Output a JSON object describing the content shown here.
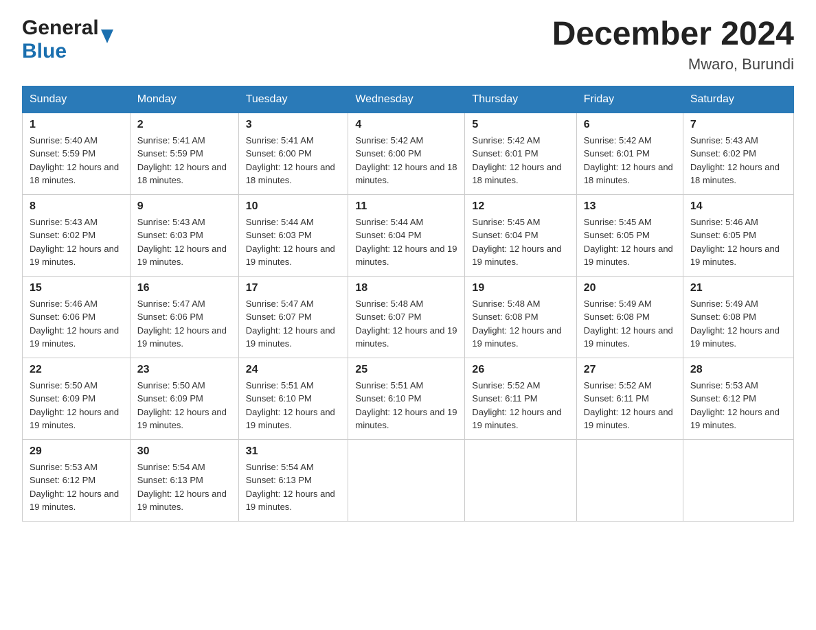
{
  "logo": {
    "general": "General",
    "blue": "Blue"
  },
  "title": "December 2024",
  "location": "Mwaro, Burundi",
  "days_header": [
    "Sunday",
    "Monday",
    "Tuesday",
    "Wednesday",
    "Thursday",
    "Friday",
    "Saturday"
  ],
  "weeks": [
    [
      {
        "day": "1",
        "sunrise": "5:40 AM",
        "sunset": "5:59 PM",
        "daylight": "12 hours and 18 minutes."
      },
      {
        "day": "2",
        "sunrise": "5:41 AM",
        "sunset": "5:59 PM",
        "daylight": "12 hours and 18 minutes."
      },
      {
        "day": "3",
        "sunrise": "5:41 AM",
        "sunset": "6:00 PM",
        "daylight": "12 hours and 18 minutes."
      },
      {
        "day": "4",
        "sunrise": "5:42 AM",
        "sunset": "6:00 PM",
        "daylight": "12 hours and 18 minutes."
      },
      {
        "day": "5",
        "sunrise": "5:42 AM",
        "sunset": "6:01 PM",
        "daylight": "12 hours and 18 minutes."
      },
      {
        "day": "6",
        "sunrise": "5:42 AM",
        "sunset": "6:01 PM",
        "daylight": "12 hours and 18 minutes."
      },
      {
        "day": "7",
        "sunrise": "5:43 AM",
        "sunset": "6:02 PM",
        "daylight": "12 hours and 18 minutes."
      }
    ],
    [
      {
        "day": "8",
        "sunrise": "5:43 AM",
        "sunset": "6:02 PM",
        "daylight": "12 hours and 19 minutes."
      },
      {
        "day": "9",
        "sunrise": "5:43 AM",
        "sunset": "6:03 PM",
        "daylight": "12 hours and 19 minutes."
      },
      {
        "day": "10",
        "sunrise": "5:44 AM",
        "sunset": "6:03 PM",
        "daylight": "12 hours and 19 minutes."
      },
      {
        "day": "11",
        "sunrise": "5:44 AM",
        "sunset": "6:04 PM",
        "daylight": "12 hours and 19 minutes."
      },
      {
        "day": "12",
        "sunrise": "5:45 AM",
        "sunset": "6:04 PM",
        "daylight": "12 hours and 19 minutes."
      },
      {
        "day": "13",
        "sunrise": "5:45 AM",
        "sunset": "6:05 PM",
        "daylight": "12 hours and 19 minutes."
      },
      {
        "day": "14",
        "sunrise": "5:46 AM",
        "sunset": "6:05 PM",
        "daylight": "12 hours and 19 minutes."
      }
    ],
    [
      {
        "day": "15",
        "sunrise": "5:46 AM",
        "sunset": "6:06 PM",
        "daylight": "12 hours and 19 minutes."
      },
      {
        "day": "16",
        "sunrise": "5:47 AM",
        "sunset": "6:06 PM",
        "daylight": "12 hours and 19 minutes."
      },
      {
        "day": "17",
        "sunrise": "5:47 AM",
        "sunset": "6:07 PM",
        "daylight": "12 hours and 19 minutes."
      },
      {
        "day": "18",
        "sunrise": "5:48 AM",
        "sunset": "6:07 PM",
        "daylight": "12 hours and 19 minutes."
      },
      {
        "day": "19",
        "sunrise": "5:48 AM",
        "sunset": "6:08 PM",
        "daylight": "12 hours and 19 minutes."
      },
      {
        "day": "20",
        "sunrise": "5:49 AM",
        "sunset": "6:08 PM",
        "daylight": "12 hours and 19 minutes."
      },
      {
        "day": "21",
        "sunrise": "5:49 AM",
        "sunset": "6:08 PM",
        "daylight": "12 hours and 19 minutes."
      }
    ],
    [
      {
        "day": "22",
        "sunrise": "5:50 AM",
        "sunset": "6:09 PM",
        "daylight": "12 hours and 19 minutes."
      },
      {
        "day": "23",
        "sunrise": "5:50 AM",
        "sunset": "6:09 PM",
        "daylight": "12 hours and 19 minutes."
      },
      {
        "day": "24",
        "sunrise": "5:51 AM",
        "sunset": "6:10 PM",
        "daylight": "12 hours and 19 minutes."
      },
      {
        "day": "25",
        "sunrise": "5:51 AM",
        "sunset": "6:10 PM",
        "daylight": "12 hours and 19 minutes."
      },
      {
        "day": "26",
        "sunrise": "5:52 AM",
        "sunset": "6:11 PM",
        "daylight": "12 hours and 19 minutes."
      },
      {
        "day": "27",
        "sunrise": "5:52 AM",
        "sunset": "6:11 PM",
        "daylight": "12 hours and 19 minutes."
      },
      {
        "day": "28",
        "sunrise": "5:53 AM",
        "sunset": "6:12 PM",
        "daylight": "12 hours and 19 minutes."
      }
    ],
    [
      {
        "day": "29",
        "sunrise": "5:53 AM",
        "sunset": "6:12 PM",
        "daylight": "12 hours and 19 minutes."
      },
      {
        "day": "30",
        "sunrise": "5:54 AM",
        "sunset": "6:13 PM",
        "daylight": "12 hours and 19 minutes."
      },
      {
        "day": "31",
        "sunrise": "5:54 AM",
        "sunset": "6:13 PM",
        "daylight": "12 hours and 19 minutes."
      },
      null,
      null,
      null,
      null
    ]
  ]
}
